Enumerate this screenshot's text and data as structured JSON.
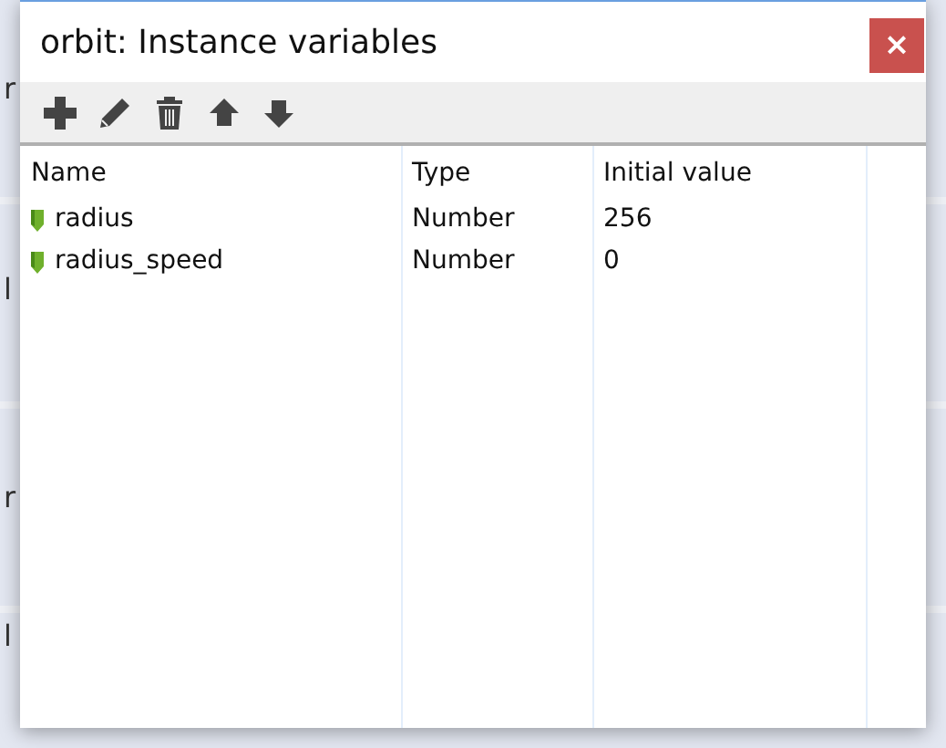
{
  "background_fragments": [
    "r",
    "l",
    "r",
    "l"
  ],
  "window": {
    "title": "orbit: Instance variables",
    "close_label": "×"
  },
  "toolbar": [
    {
      "kind": "add"
    },
    {
      "kind": "edit"
    },
    {
      "kind": "delete"
    },
    {
      "kind": "up"
    },
    {
      "kind": "down"
    }
  ],
  "table": {
    "columns": [
      "Name",
      "Type",
      "Initial value"
    ],
    "rows": [
      {
        "name": "radius",
        "type": "Number",
        "initial_value": "256"
      },
      {
        "name": "radius_speed",
        "type": "Number",
        "initial_value": "0"
      }
    ]
  }
}
